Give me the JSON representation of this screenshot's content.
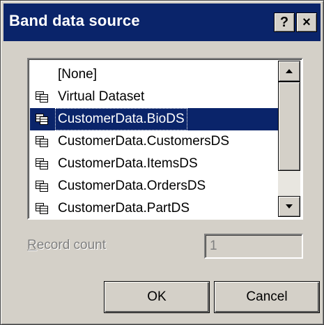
{
  "window": {
    "title": "Band data source",
    "help_glyph": "?",
    "close_glyph": "×"
  },
  "listbox": {
    "items": [
      {
        "label": "[None]",
        "icon": "none"
      },
      {
        "label": "Virtual Dataset",
        "icon": "dataset-icon"
      },
      {
        "label": "CustomerData.BioDS",
        "icon": "dataset-icon",
        "selected": true
      },
      {
        "label": "CustomerData.CustomersDS",
        "icon": "dataset-icon"
      },
      {
        "label": "CustomerData.ItemsDS",
        "icon": "dataset-icon"
      },
      {
        "label": "CustomerData.OrdersDS",
        "icon": "dataset-icon"
      },
      {
        "label": "CustomerData.PartDS",
        "icon": "dataset-icon"
      }
    ]
  },
  "record_count": {
    "label_mnemonic": "R",
    "label_rest": "ecord count",
    "value": "1"
  },
  "buttons": {
    "ok": "OK",
    "cancel": "Cancel"
  },
  "colors": {
    "title_bar": "#0a246a",
    "dialog_face": "#d4d0c8",
    "selection": "#0a246a",
    "disabled_text": "#808080"
  }
}
